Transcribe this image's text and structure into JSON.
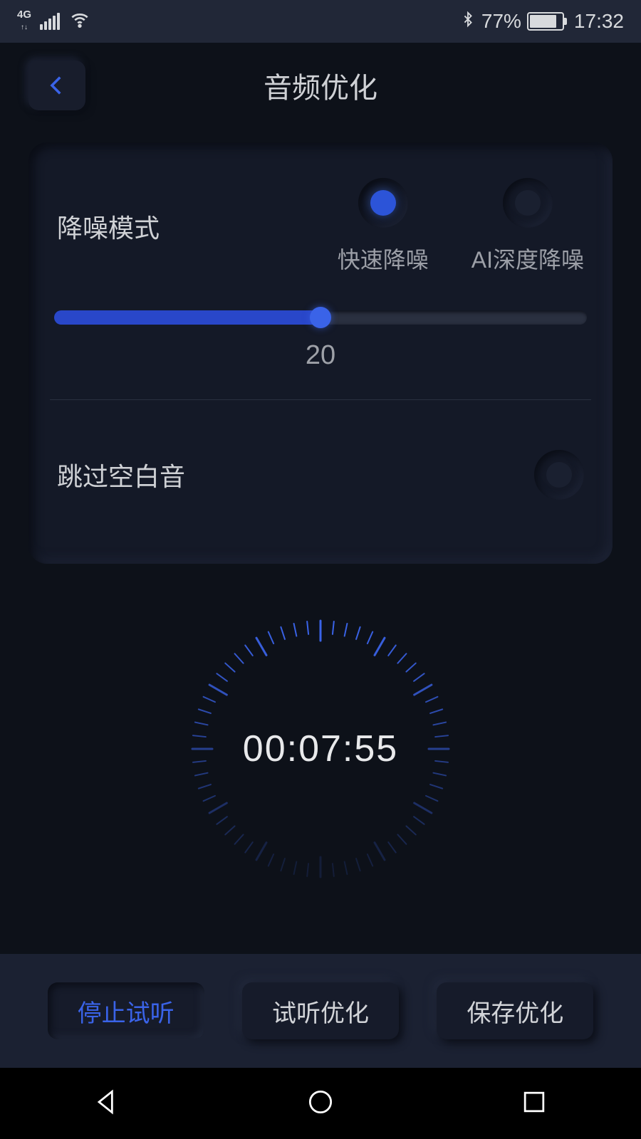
{
  "status": {
    "network": "4G",
    "bluetooth": true,
    "battery_percent": "77%",
    "time": "17:32"
  },
  "header": {
    "title": "音频优化"
  },
  "noise": {
    "label": "降噪模式",
    "options": {
      "fast": "快速降噪",
      "ai_deep": "AI深度降噪"
    },
    "selected": "fast",
    "slider_value": "20",
    "slider_percent": 50
  },
  "skip_silence": {
    "label": "跳过空白音",
    "enabled": false
  },
  "timer": {
    "display": "00:07:55"
  },
  "actions": {
    "stop_preview": "停止试听",
    "preview_optimize": "试听优化",
    "save_optimize": "保存优化"
  }
}
